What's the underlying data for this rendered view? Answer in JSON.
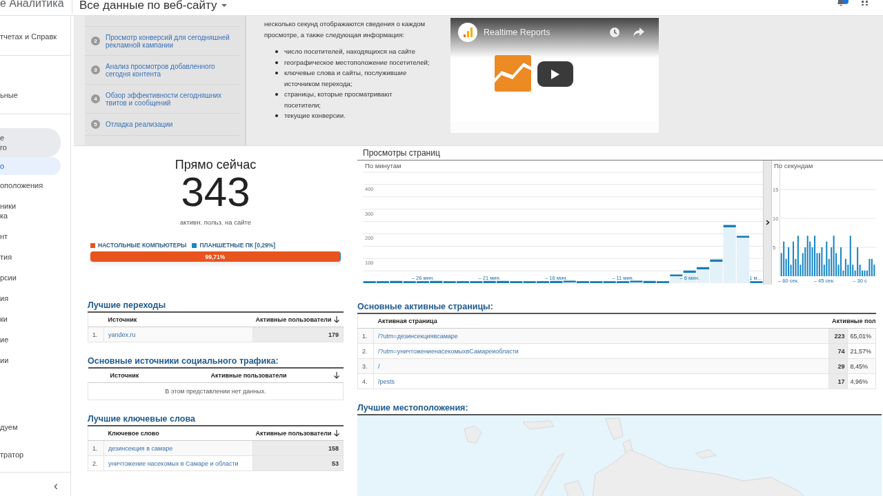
{
  "header": {
    "product": "е Аналитика",
    "view_selector": "Все данные по веб-сайту"
  },
  "sidebar": {
    "groups": [
      [
        {
          "label": "тчетах и Справк",
          "selected": false,
          "highlighted": false
        }
      ],
      [
        {
          "label": "ьные",
          "selected": false,
          "highlighted": false
        }
      ],
      [
        {
          "label": "е\nго",
          "selected": false,
          "highlighted": true
        },
        {
          "label": "о",
          "selected": true,
          "highlighted": false
        },
        {
          "label": "оположения",
          "selected": false,
          "highlighted": false
        },
        {
          "label": "ники\nка",
          "selected": false,
          "highlighted": false
        },
        {
          "label": "нт",
          "selected": false,
          "highlighted": false
        },
        {
          "label": "тия",
          "selected": false,
          "highlighted": false
        },
        {
          "label": "рсии",
          "selected": false,
          "highlighted": false
        },
        {
          "label": "ия",
          "selected": false,
          "highlighted": false
        },
        {
          "label": "ки",
          "selected": false,
          "highlighted": false
        },
        {
          "label": "ие",
          "selected": false,
          "highlighted": false
        },
        {
          "label": "ии",
          "selected": false,
          "highlighted": false
        }
      ]
    ],
    "footer_items": [
      {
        "label": "дуем",
        "selected": false,
        "highlighted": false
      },
      {
        "label": "тратор",
        "selected": false,
        "highlighted": false
      }
    ],
    "collapse": "‹"
  },
  "guide": {
    "steps": [
      {
        "number": "2",
        "label": "Просмотр конверсий для сегодняшней рекламной кампании"
      },
      {
        "number": "3",
        "label": "Анализ просмотров добавленного сегодня контента"
      },
      {
        "number": "4",
        "label": "Обзор эффективности сегодняшних твитов и сообщений"
      },
      {
        "number": "5",
        "label": "Отладка реализации"
      }
    ],
    "intro": "несколько секунд отображаются сведения о каждом просмотре, а также следующая информация:",
    "bullets": [
      "число посетителей, находящихся на сайте",
      "географическое местоположение посетителей;",
      "ключевые слова и сайты, послужившие источником перехода;",
      "страницы, которые просматривают посетители;",
      "текущие конверсии."
    ]
  },
  "video": {
    "title": "Realtime Reports"
  },
  "now": {
    "title": "Прямо сейчас",
    "count": "343",
    "caption": "активн. польз. на сайте",
    "segments": [
      {
        "label": "НАСТОЛЬНЫЕ КОМПЬЮТЕРЫ",
        "color": "#e8541d",
        "level": 0.9971,
        "value_label": "99,71%"
      },
      {
        "label": "ПЛАНШЕТНЫЕ ПК [0,29%]",
        "color": "#1a87c4",
        "level": 0.0029
      }
    ]
  },
  "pageviews": {
    "title": "Просмотры страниц",
    "minutes": {
      "label": "По минутам",
      "chart_data": {
        "type": "bar",
        "x": [
          -30,
          -29,
          -28,
          -27,
          -26,
          -25,
          -24,
          -23,
          -22,
          -21,
          -20,
          -19,
          -18,
          -17,
          -16,
          -15,
          -14,
          -13,
          -12,
          -11,
          -10,
          -9,
          -8,
          -7,
          -6,
          -5,
          -4,
          -3,
          -2,
          -1
        ],
        "values": [
          8,
          8,
          9,
          8,
          8,
          9,
          8,
          8,
          8,
          9,
          9,
          8,
          8,
          8,
          9,
          10,
          8,
          8,
          8,
          8,
          10,
          9,
          8,
          35,
          51,
          65,
          96,
          236,
          192,
          8
        ],
        "xlim": [
          -30.5,
          -0.5
        ],
        "ylim": [
          0,
          450
        ],
        "yticks": [
          100,
          200,
          300,
          400
        ],
        "grid": true,
        "xticks": [
          {
            "value": -26,
            "label": "– 26 мин."
          },
          {
            "value": -21,
            "label": "– 21 мин."
          },
          {
            "value": -16,
            "label": "– 16 мин."
          },
          {
            "value": -11,
            "label": "– 11 мин."
          },
          {
            "value": -6,
            "label": "– 6 мин."
          },
          {
            "value": -1,
            "label": "1 м..."
          }
        ]
      }
    },
    "seconds": {
      "label": "По секундам",
      "chart_data": {
        "type": "bar",
        "x": [
          -63,
          -62,
          -61,
          -60,
          -59,
          -58,
          -57,
          -56,
          -55,
          -54,
          -53,
          -52,
          -51,
          -50,
          -49,
          -48,
          -47,
          -46,
          -45,
          -44,
          -43,
          -42,
          -41,
          -40,
          -39,
          -38,
          -37,
          -36,
          -35,
          -34,
          -33,
          -32,
          -31,
          -30,
          -29,
          -28,
          -27,
          -26,
          -25,
          -24
        ],
        "values": [
          4,
          6,
          3,
          5,
          2,
          6,
          3,
          7,
          2,
          4,
          5,
          7,
          6,
          5,
          7,
          4,
          4,
          5,
          2,
          6,
          3,
          5,
          7,
          4,
          2,
          5,
          1,
          3,
          2,
          7,
          2,
          1,
          5,
          2,
          1,
          1,
          1,
          3,
          3,
          2
        ],
        "xlim": [
          -63.5,
          -23.5
        ],
        "ylim": [
          0,
          20
        ],
        "yticks": [
          5,
          10,
          15
        ],
        "grid": true,
        "xticks": [
          {
            "value": -60,
            "label": "– 60 сек."
          },
          {
            "value": -45,
            "label": "– 45 сек."
          },
          {
            "value": -30,
            "label": "– 30 с"
          }
        ]
      }
    }
  },
  "top_referrals": {
    "title": "Лучшие переходы",
    "columns": [
      "Источник",
      "Активные пользователи"
    ],
    "rows": [
      {
        "number": "1.",
        "name": "yandex.ru",
        "value": "179"
      }
    ]
  },
  "social": {
    "title": "Основные источники социального трафика:",
    "columns": [
      "Источник",
      "Активные пользователи"
    ],
    "empty_message": "В этом представлении нет данных."
  },
  "keywords": {
    "title": "Лучшие ключевые слова",
    "columns": [
      "Ключевое слово",
      "Активные пользователи"
    ],
    "rows": [
      {
        "number": "1.",
        "name": "дезинсекция в самаре",
        "value": "158"
      },
      {
        "number": "2.",
        "name": "уничтожение насекомых в Самаре и области",
        "value": "53"
      }
    ]
  },
  "active_pages": {
    "title": "Основные активные страницы:",
    "columns": [
      "Активная страница",
      "Активные пол"
    ],
    "rows": [
      {
        "number": "1.",
        "page": "/?utm=дезинсекциявсамаре",
        "value": "223",
        "share": "65,01%"
      },
      {
        "number": "2.",
        "page": "/?utm=уничтожениенасекомыхвСамареиобласти",
        "value": "74",
        "share": "21,57%"
      },
      {
        "number": "3.",
        "page": "/",
        "value": "29",
        "share": "8,45%"
      },
      {
        "number": "4.",
        "page": "/pests",
        "value": "17",
        "share": "4,96%"
      }
    ]
  },
  "locations": {
    "title": "Лучшие местоположения:",
    "kind": "picture"
  }
}
